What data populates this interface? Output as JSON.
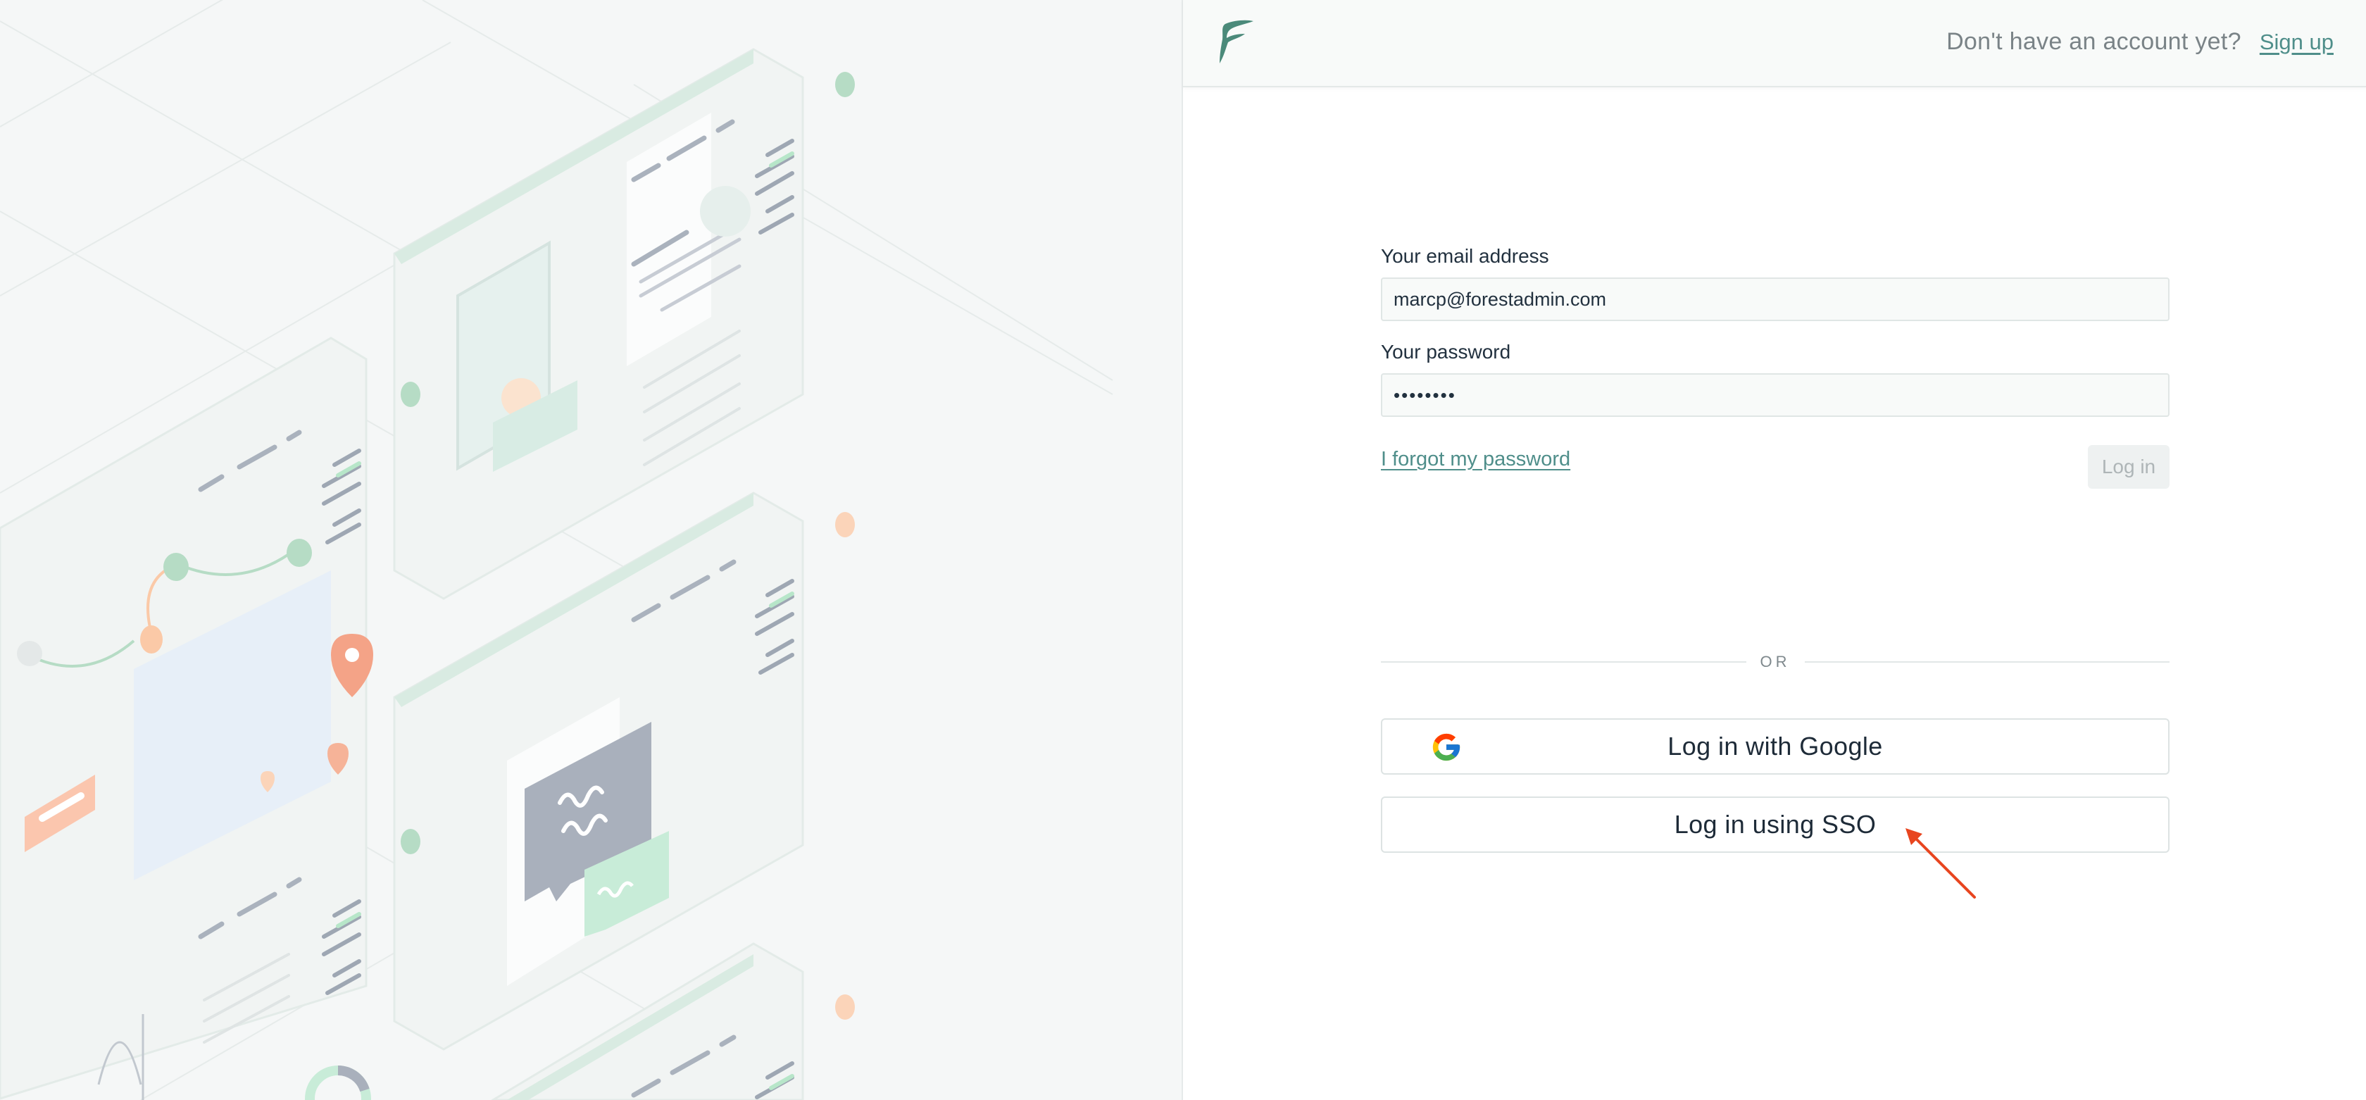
{
  "header": {
    "logo_icon": "forest-admin-logo-icon",
    "signup_prompt": "Don't have an account yet?",
    "signup_link": "Sign up"
  },
  "form": {
    "email_label": "Your email address",
    "email_value": "marcp@forestadmin.com",
    "password_label": "Your password",
    "password_value": "••••••••",
    "forgot_link": "I forgot my password",
    "login_button": "Log in"
  },
  "divider": {
    "text": "OR"
  },
  "sso": {
    "google_button": "Log in with Google",
    "google_icon": "google-g-icon",
    "sso_button": "Log in using SSO"
  },
  "colors": {
    "accent": "#4f8e8a",
    "annotation_arrow": "#e8451f",
    "panel_bg": "#f5f7f7"
  }
}
